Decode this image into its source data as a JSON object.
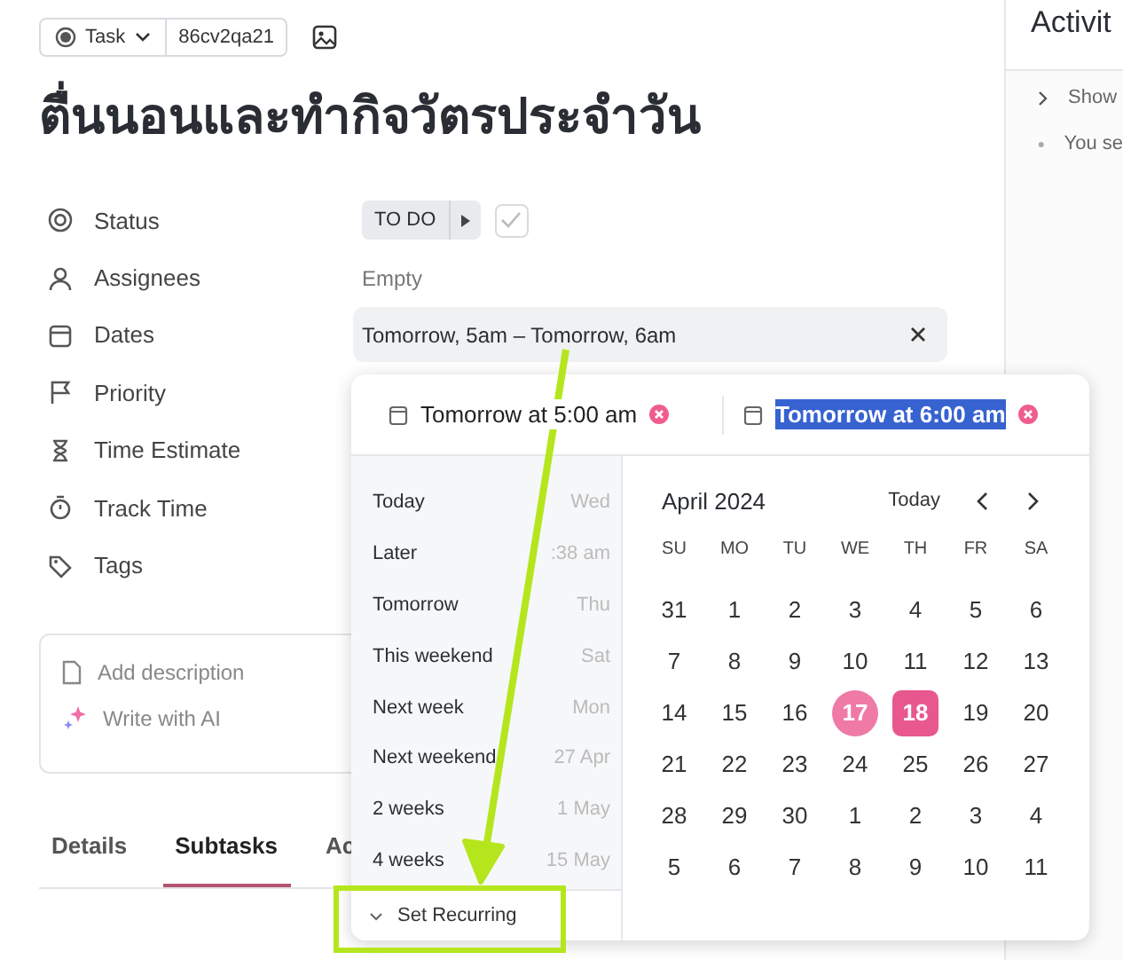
{
  "header": {
    "type_label": "Task",
    "task_id": "86cv2qa21"
  },
  "title": "ตื่นนอนและทำกิจวัตรประจำวัน",
  "properties": [
    {
      "kind": "status",
      "label": "Status",
      "value": "TO DO"
    },
    {
      "kind": "empty",
      "label": "Assignees",
      "value": "Empty"
    },
    {
      "kind": "date",
      "label": "Dates",
      "value": "Tomorrow, 5am – Tomorrow, 6am"
    },
    {
      "kind": "none",
      "label": "Priority"
    },
    {
      "kind": "none",
      "label": "Time Estimate"
    },
    {
      "kind": "none",
      "label": "Track Time"
    },
    {
      "kind": "none",
      "label": "Tags"
    }
  ],
  "description": {
    "add": "Add description",
    "ai": "Write with AI"
  },
  "tabs": [
    {
      "label": "Details",
      "selected": false
    },
    {
      "label": "Subtasks",
      "selected": true
    },
    {
      "label": "Ac",
      "selected": false
    }
  ],
  "activity": {
    "title": "Activit",
    "items": [
      {
        "kind": "expand",
        "text": "Show"
      },
      {
        "kind": "bullet",
        "text": "You se"
      }
    ]
  },
  "date_picker": {
    "start": {
      "value": "Tomorrow at 5:00 am",
      "highlighted": false
    },
    "end": {
      "value": "Tomorrow at 6:00 am",
      "highlighted": true
    },
    "quick_options": [
      {
        "label": "Today",
        "hint": "Wed"
      },
      {
        "label": "Later",
        "hint": ":38 am"
      },
      {
        "label": "Tomorrow",
        "hint": "Thu"
      },
      {
        "label": "This weekend",
        "hint": "Sat"
      },
      {
        "label": "Next week",
        "hint": "Mon"
      },
      {
        "label": "Next weekend",
        "hint": "27 Apr"
      },
      {
        "label": "2 weeks",
        "hint": "1 May"
      },
      {
        "label": "4 weeks",
        "hint": "15 May"
      }
    ],
    "recurring": "Set Recurring",
    "month": "April 2024",
    "today_button": "Today",
    "weekdays": [
      "SU",
      "MO",
      "TU",
      "WE",
      "TH",
      "FR",
      "SA"
    ],
    "days": [
      {
        "label": "31",
        "today": false,
        "selected": false
      },
      {
        "label": "1",
        "today": false,
        "selected": false
      },
      {
        "label": "2",
        "today": false,
        "selected": false
      },
      {
        "label": "3",
        "today": false,
        "selected": false
      },
      {
        "label": "4",
        "today": false,
        "selected": false
      },
      {
        "label": "5",
        "today": false,
        "selected": false
      },
      {
        "label": "6",
        "today": false,
        "selected": false
      },
      {
        "label": "7",
        "today": false,
        "selected": false
      },
      {
        "label": "8",
        "today": false,
        "selected": false
      },
      {
        "label": "9",
        "today": false,
        "selected": false
      },
      {
        "label": "10",
        "today": false,
        "selected": false
      },
      {
        "label": "11",
        "today": false,
        "selected": false
      },
      {
        "label": "12",
        "today": false,
        "selected": false
      },
      {
        "label": "13",
        "today": false,
        "selected": false
      },
      {
        "label": "14",
        "today": false,
        "selected": false
      },
      {
        "label": "15",
        "today": false,
        "selected": false
      },
      {
        "label": "16",
        "today": false,
        "selected": false
      },
      {
        "label": "17",
        "today": true,
        "selected": false
      },
      {
        "label": "18",
        "today": false,
        "selected": true
      },
      {
        "label": "19",
        "today": false,
        "selected": false
      },
      {
        "label": "20",
        "today": false,
        "selected": false
      },
      {
        "label": "21",
        "today": false,
        "selected": false
      },
      {
        "label": "22",
        "today": false,
        "selected": false
      },
      {
        "label": "23",
        "today": false,
        "selected": false
      },
      {
        "label": "24",
        "today": false,
        "selected": false
      },
      {
        "label": "25",
        "today": false,
        "selected": false
      },
      {
        "label": "26",
        "today": false,
        "selected": false
      },
      {
        "label": "27",
        "today": false,
        "selected": false
      },
      {
        "label": "28",
        "today": false,
        "selected": false
      },
      {
        "label": "29",
        "today": false,
        "selected": false
      },
      {
        "label": "30",
        "today": false,
        "selected": false
      },
      {
        "label": "1",
        "today": false,
        "selected": false
      },
      {
        "label": "2",
        "today": false,
        "selected": false
      },
      {
        "label": "3",
        "today": false,
        "selected": false
      },
      {
        "label": "4",
        "today": false,
        "selected": false
      },
      {
        "label": "5",
        "today": false,
        "selected": false
      },
      {
        "label": "6",
        "today": false,
        "selected": false
      },
      {
        "label": "7",
        "today": false,
        "selected": false
      },
      {
        "label": "8",
        "today": false,
        "selected": false
      },
      {
        "label": "9",
        "today": false,
        "selected": false
      },
      {
        "label": "10",
        "today": false,
        "selected": false
      },
      {
        "label": "11",
        "today": false,
        "selected": false
      }
    ]
  }
}
